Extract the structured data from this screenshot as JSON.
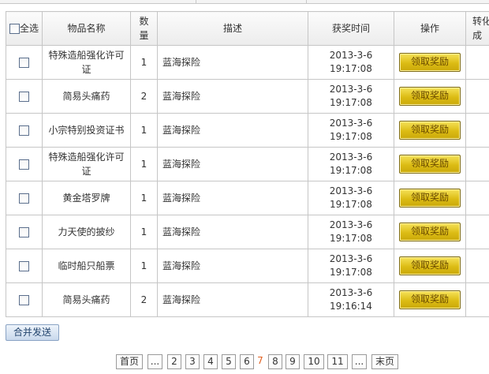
{
  "header": {
    "select_all": "全选",
    "item_name": "物品名称",
    "quantity": "数量",
    "description": "描述",
    "award_time": "获奖时间",
    "action": "操作",
    "convert": "转化成"
  },
  "rows": [
    {
      "name": "特殊造船强化许可证",
      "qty": "1",
      "desc": "蓝海探险",
      "date": "2013-3-6",
      "time": "19:17:08",
      "button": "领取奖励"
    },
    {
      "name": "简易头痛药",
      "qty": "2",
      "desc": "蓝海探险",
      "date": "2013-3-6",
      "time": "19:17:08",
      "button": "领取奖励"
    },
    {
      "name": "小宗特别投资证书",
      "qty": "1",
      "desc": "蓝海探险",
      "date": "2013-3-6",
      "time": "19:17:08",
      "button": "领取奖励"
    },
    {
      "name": "特殊造船强化许可证",
      "qty": "1",
      "desc": "蓝海探险",
      "date": "2013-3-6",
      "time": "19:17:08",
      "button": "领取奖励"
    },
    {
      "name": "黄金塔罗牌",
      "qty": "1",
      "desc": "蓝海探险",
      "date": "2013-3-6",
      "time": "19:17:08",
      "button": "领取奖励"
    },
    {
      "name": "力天使的披纱",
      "qty": "1",
      "desc": "蓝海探险",
      "date": "2013-3-6",
      "time": "19:17:08",
      "button": "领取奖励"
    },
    {
      "name": "临时船只船票",
      "qty": "1",
      "desc": "蓝海探险",
      "date": "2013-3-6",
      "time": "19:17:08",
      "button": "领取奖励"
    },
    {
      "name": "简易头痛药",
      "qty": "2",
      "desc": "蓝海探险",
      "date": "2013-3-6",
      "time": "19:16:14",
      "button": "领取奖励"
    }
  ],
  "footer": {
    "merge_send": "合并发送"
  },
  "pagination": {
    "first": "首页",
    "ellipsis_left": "...",
    "pages": [
      "2",
      "3",
      "4",
      "5",
      "6",
      "7",
      "8",
      "9",
      "10",
      "11"
    ],
    "current": "7",
    "ellipsis_right": "...",
    "last": "末页"
  },
  "colors": {
    "current_page": "#e06020",
    "claim_button": "#dcbc14",
    "merge_button": "#c8d8ec"
  }
}
